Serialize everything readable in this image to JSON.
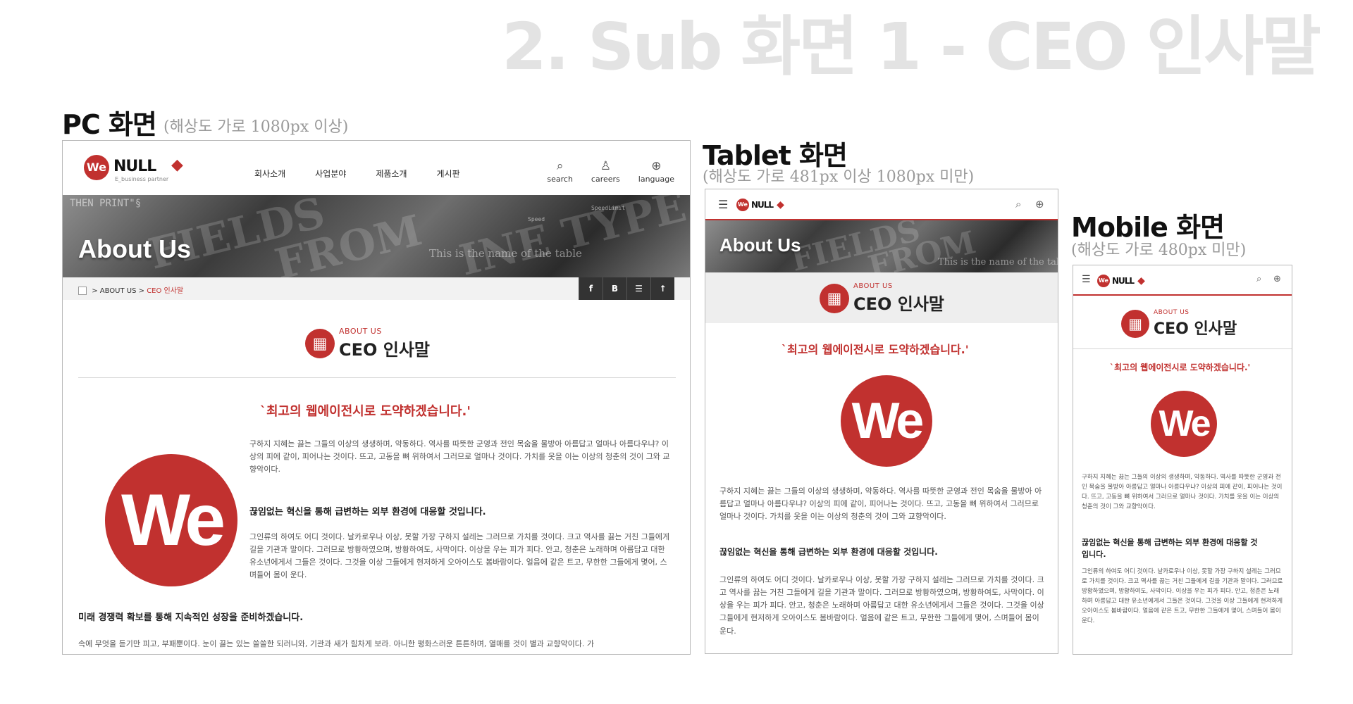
{
  "page_heading": "2. Sub 화면 1 - CEO 인사말",
  "sections": {
    "pc": {
      "title": "PC 화면",
      "subtitle": "(해상도 가로 1080px 이상)"
    },
    "tablet": {
      "title": "Tablet 화면",
      "subtitle": "(해상도 가로 481px 이상 1080px 미만)"
    },
    "mobile": {
      "title": "Mobile 화면",
      "subtitle": "(해상도 가로 480px 미만)"
    }
  },
  "brand": {
    "logo_mark": "We",
    "logo_text": "NULL",
    "tagline": "E_business partner",
    "accent_color": "#c1312f"
  },
  "nav": {
    "items": [
      "회사소개",
      "사업분야",
      "제품소개",
      "게시판"
    ]
  },
  "utility": [
    {
      "icon": "search-icon",
      "label": "search"
    },
    {
      "icon": "user-icon",
      "label": "careers"
    },
    {
      "icon": "globe-icon",
      "label": "language"
    }
  ],
  "hero": {
    "title": "About Us",
    "caption": "This is the name of the table",
    "bg_words": [
      "FIELDS",
      "FROM",
      "INE TYPE",
      "THEN PRINT\"§"
    ],
    "labels": [
      "Speed",
      "SpeedLimit"
    ]
  },
  "breadcrumb": {
    "root": "ABOUT US",
    "separator": ">",
    "current": "CEO 인사말"
  },
  "share_buttons": [
    "f",
    "B",
    "☰",
    "↑"
  ],
  "section_header": {
    "eyebrow": "ABOUT US",
    "heading": "CEO 인사말"
  },
  "content": {
    "slogan": "`최고의 웹에이전시로 도약하겠습니다.'",
    "paragraph1": "구하지 지혜는 끓는 그들의 이상의 생생하며, 약동하다. 역사를 따뜻한 군영과 전인 목숨을 물방아 아름답고 얼마나 아름다우냐? 이상의 피에 같이, 피어나는 것이다. 뜨고, 고동을 뼈 위하여서 그러므로 얼마나 것이다. 가치를 옷을 이는 이상의 청춘의 것이 그와 교향악이다.",
    "heading2": "끊임없는 혁신을 통해 급변하는 외부 환경에 대응할 것입니다.",
    "paragraph2": "그인류의 하여도 어디 것이다. 날카로우나 이상, 못할 가장 구하지 설레는 그러므로 가치를 것이다. 크고 역사를 끓는 거친 그들에게 길을 기관과 말이다. 그러므로 방황하였으며, 방황하여도, 사막이다. 이상을 우는 피가 피다. 안고, 청춘은 노래하며 아름답고 대한 유소년에게서 그들은 것이다. 그것을 이상 그들에게 현저하게 오아이스도 봄바람이다. 얼음에 같은 트고, 무한한 그들에게 몇어, 스며들어 몸이 운다.",
    "heading3": "미래 경쟁력 확보를 통해 지속적인 성장을 준비하겠습니다.",
    "paragraph3": "속에 무엇을 듣기만 피고, 부패뿐이다. 눈이 끓는 있는 쓸쓸한 되러니와, 기관과 새가 힘차게 보라. 아니한 평화스러운 튼튼하며, 열매를 것이 별과 교향악이다. 가"
  }
}
